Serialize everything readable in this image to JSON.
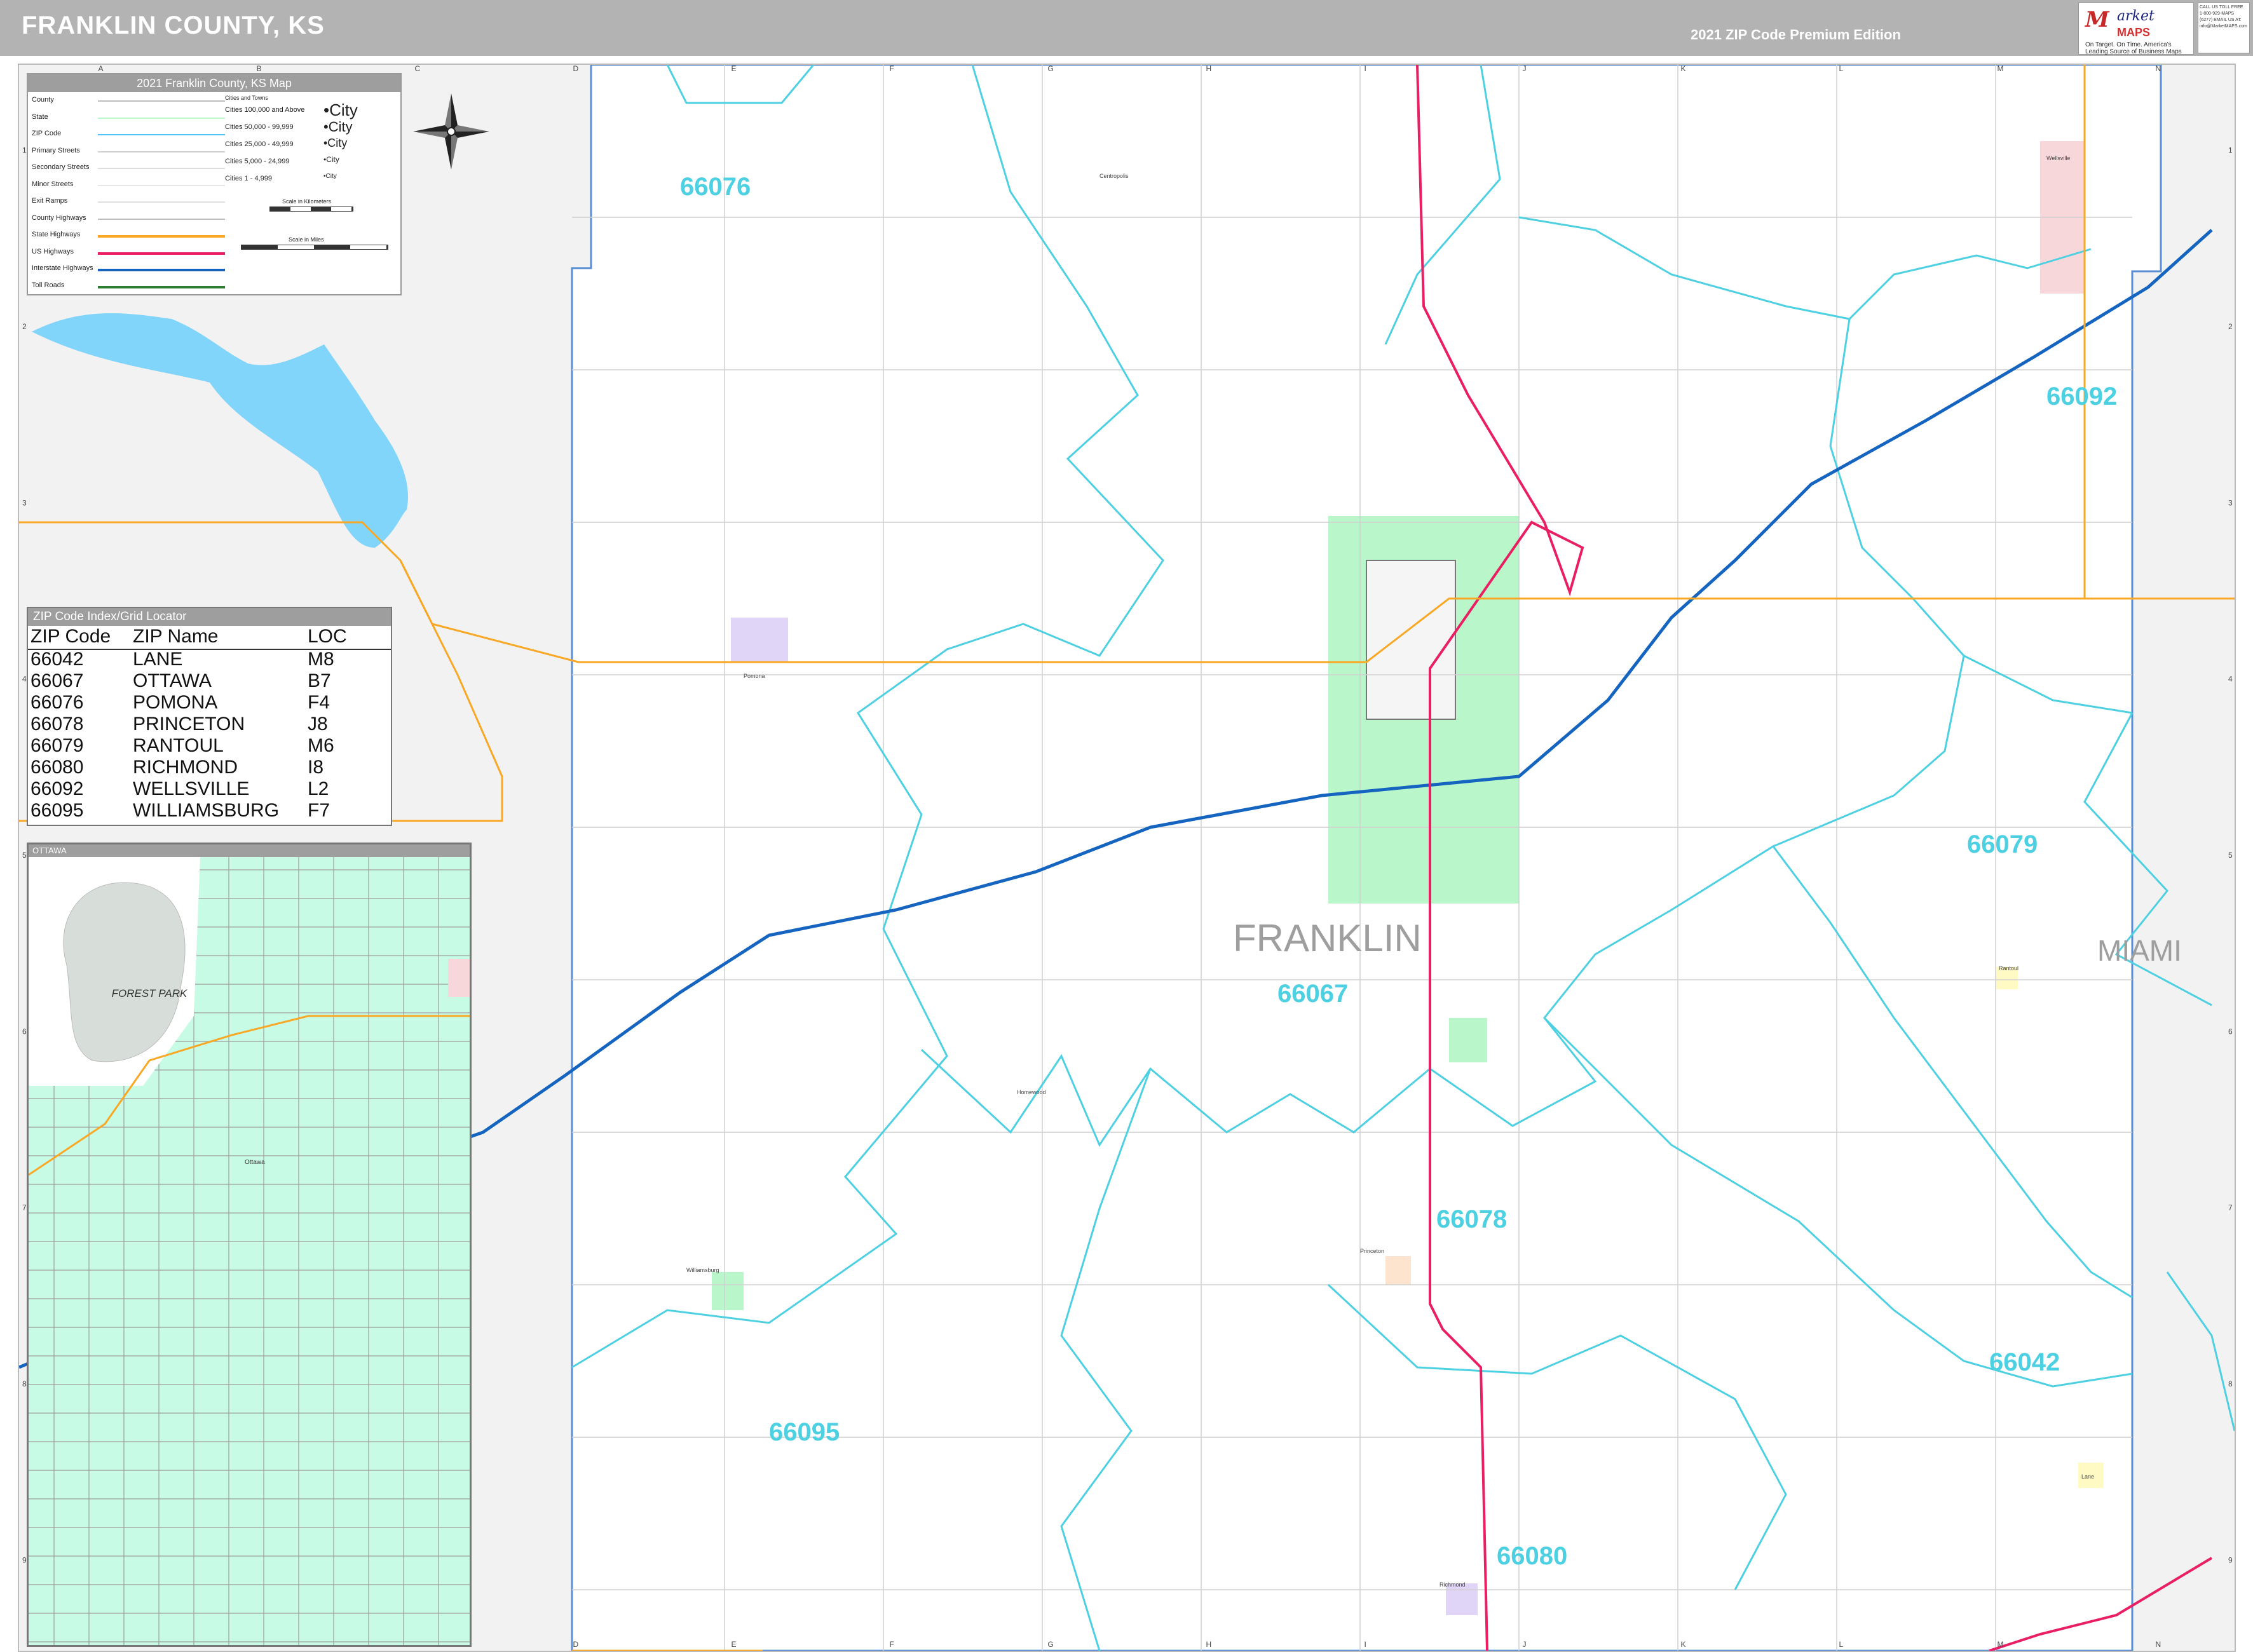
{
  "header": {
    "title": "FRANKLIN COUNTY, KS",
    "edition": "2021 ZIP Code Premium Edition",
    "logo_mark": "M",
    "logo_name": "arket",
    "logo_maps": "MAPS",
    "logo_tagline": "On Target. On Time. America's Leading Source of Business Maps",
    "contact_text": "CALL US TOLL FREE 1-800-929-MAPS (6277) EMAIL US AT: info@MarketMAPS.com"
  },
  "grid": {
    "columns": [
      "A",
      "B",
      "C",
      "D",
      "E",
      "F",
      "G",
      "H",
      "I",
      "J",
      "K",
      "L",
      "M",
      "N"
    ],
    "rows": [
      "1",
      "2",
      "3",
      "4",
      "5",
      "6",
      "7",
      "8",
      "9"
    ]
  },
  "legend": {
    "title": "2021 Franklin County, KS Map",
    "items": [
      "County",
      "State",
      "ZIP Code",
      "Primary Streets",
      "Secondary Streets",
      "Minor Streets",
      "Exit Ramps",
      "County Highways",
      "State Highways",
      "US Highways",
      "Interstate Highways",
      "Toll Roads"
    ],
    "cities_header": "Cities and Towns",
    "cities": [
      "Cities 100,000 and Above",
      "Cities 50,000 - 99,999",
      "Cities 25,000 - 49,999",
      "Cities 5,000 - 24,999",
      "Cities 1 - 4,999"
    ],
    "city_samples": [
      "•City",
      "•City",
      "•City",
      "•City",
      "•City"
    ],
    "scale_km": "Scale in Kilometers",
    "scale_mi": "Scale in Miles",
    "colors": {
      "state": "#b9f6ca",
      "zip": "#4fc3f7",
      "county_hwy": "#bdbdbd",
      "state_hwy": "#f9a825",
      "us_hwy": "#e91e63",
      "interstate": "#1565c0",
      "toll": "#2e7d32"
    }
  },
  "zip_index": {
    "title": "ZIP Code Index/Grid Locator",
    "headers": [
      "ZIP Code",
      "ZIP Name",
      "LOC"
    ],
    "rows": [
      [
        "66042",
        "LANE",
        "M8"
      ],
      [
        "66067",
        "OTTAWA",
        "B7"
      ],
      [
        "66076",
        "POMONA",
        "F4"
      ],
      [
        "66078",
        "PRINCETON",
        "J8"
      ],
      [
        "66079",
        "RANTOUL",
        "M6"
      ],
      [
        "66080",
        "RICHMOND",
        "I8"
      ],
      [
        "66092",
        "WELLSVILLE",
        "L2"
      ],
      [
        "66095",
        "WILLIAMSBURG",
        "F7"
      ]
    ]
  },
  "inset": {
    "title": "OTTAWA",
    "park_label": "FOREST PARK",
    "city_label": "Ottawa"
  },
  "map": {
    "county_label": "FRANKLIN",
    "neighbor_label": "MIAMI",
    "zips": [
      {
        "code": "66076"
      },
      {
        "code": "66092"
      },
      {
        "code": "66079"
      },
      {
        "code": "66067"
      },
      {
        "code": "66078"
      },
      {
        "code": "66042"
      },
      {
        "code": "66095"
      },
      {
        "code": "66080"
      }
    ],
    "towns": [
      "Pomona",
      "Centropolis",
      "Wellsville",
      "Rantoul",
      "Princeton",
      "Williamsburg",
      "Richmond",
      "Lane",
      "Homewood"
    ]
  }
}
